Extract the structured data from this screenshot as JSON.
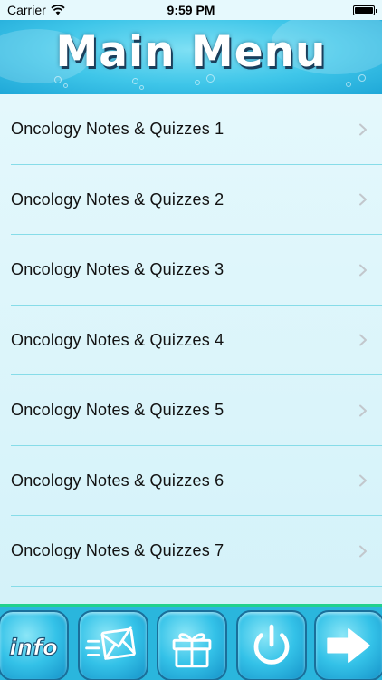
{
  "status_bar": {
    "carrier": "Carrier",
    "time": "9:59 PM"
  },
  "header": {
    "title": "Main Menu"
  },
  "menu": {
    "items": [
      {
        "label": "Oncology Notes & Quizzes 1"
      },
      {
        "label": "Oncology Notes & Quizzes 2"
      },
      {
        "label": "Oncology Notes & Quizzes 3"
      },
      {
        "label": "Oncology Notes & Quizzes 4"
      },
      {
        "label": "Oncology Notes & Quizzes 5"
      },
      {
        "label": "Oncology Notes & Quizzes 6"
      },
      {
        "label": "Oncology Notes & Quizzes 7"
      }
    ]
  },
  "toolbar": {
    "info_label": "info",
    "buttons": [
      "info-icon",
      "mail-icon",
      "gift-icon",
      "power-icon",
      "arrow-right-icon"
    ]
  },
  "colors": {
    "header": "#3fc6e9",
    "list_background": "#d9f4fa",
    "separator": "#86dce8",
    "toolbar": "#2ab6dd",
    "toolbar_border": "#22d18d"
  }
}
